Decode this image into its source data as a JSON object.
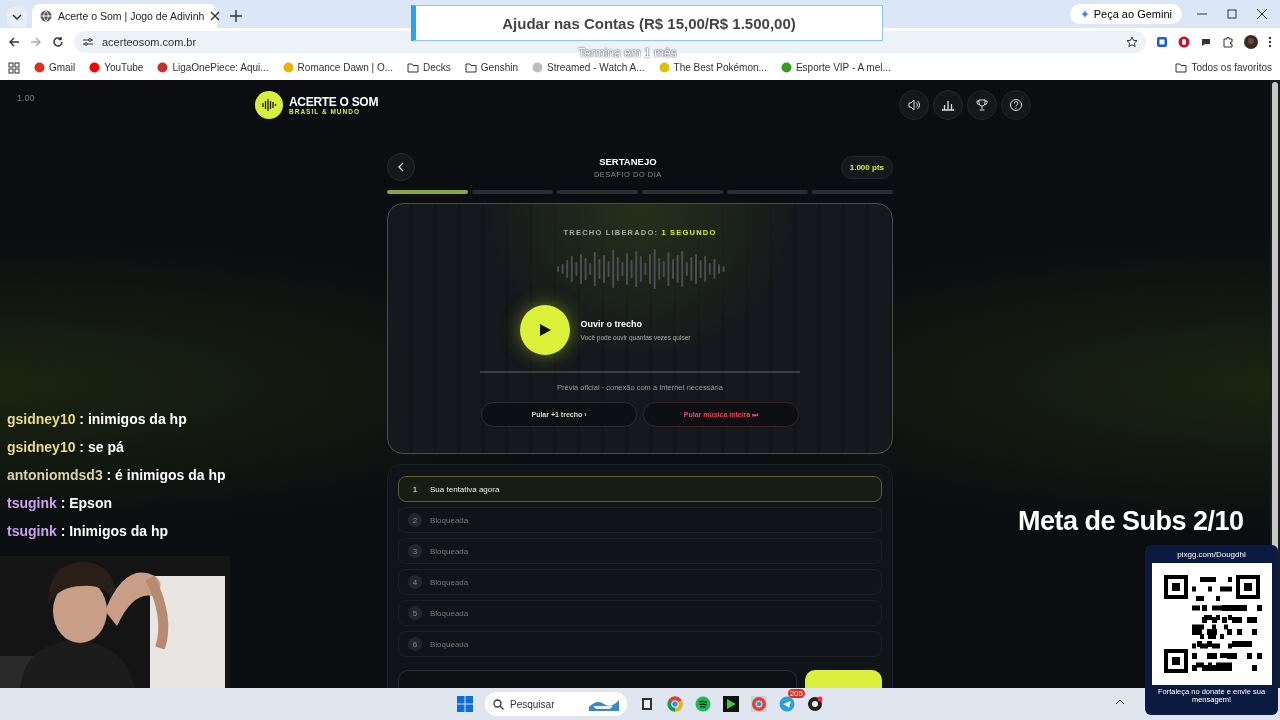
{
  "browser": {
    "tab_title": "Acerte o Som | Jogo de Adivinh",
    "url": "acerteosom.com.br",
    "gemini": "Peça ao Gemini",
    "all_bookmarks": "Todos os favoritos",
    "bookmarks": [
      {
        "label": "Gmail",
        "kind": "site"
      },
      {
        "label": "YouTube",
        "kind": "site"
      },
      {
        "label": "LigaOnePiece: Aqui...",
        "kind": "site"
      },
      {
        "label": "Romance Dawn | O...",
        "kind": "site"
      },
      {
        "label": "Decks",
        "kind": "folder"
      },
      {
        "label": "Genshin",
        "kind": "folder"
      },
      {
        "label": "Streamed - Watch A...",
        "kind": "site"
      },
      {
        "label": "The Best Pokémon...",
        "kind": "site"
      },
      {
        "label": "Esporte VIP - A mel...",
        "kind": "site"
      }
    ]
  },
  "zoom_level": "1.00",
  "app": {
    "logo_title": "ACERTE O SOM",
    "logo_subtitle": "BRASIL & MUNDO",
    "genre": "SERTANEJO",
    "mode": "DESAFIO DO DIA",
    "points": "1.000 pts",
    "progress": [
      {
        "done": true
      },
      {
        "done": false
      },
      {
        "done": false
      },
      {
        "done": false
      },
      {
        "done": false
      },
      {
        "done": false
      }
    ],
    "unlocked_label": "TRECHO LIBERADO:",
    "unlocked_value": "1 SEGUNDO",
    "play_title": "Ouvir o trecho",
    "play_hint": "Você pode ouvir quantas vezes quiser",
    "note": "Prévia oficial · conexão com a Internet necessária",
    "skip_one": "Pular +1 trecho ›",
    "skip_all": "Pular música inteira ⏭",
    "attempts": [
      {
        "number": "1",
        "label": "Sua tentativa agora",
        "current": true
      },
      {
        "number": "2",
        "label": "Bloqueada",
        "current": false
      },
      {
        "number": "3",
        "label": "Bloqueada",
        "current": false
      },
      {
        "number": "4",
        "label": "Bloqueada",
        "current": false
      },
      {
        "number": "5",
        "label": "Bloqueada",
        "current": false
      },
      {
        "number": "6",
        "label": "Bloqueada",
        "current": false
      }
    ]
  },
  "overlay": {
    "donation": "Ajudar nas Contas (R$ 15,00/R$ 1.500,00)",
    "donation_timer": "Termina em 1 mês",
    "chat": [
      {
        "user": "gsidney10",
        "message": ": inimigos da hp",
        "color": "#eadb8e"
      },
      {
        "user": "gsidney10",
        "message": ": se pá",
        "color": "#eadb8e"
      },
      {
        "user": "antoniomdsd3",
        "message": ": é inimigos da hp",
        "color": "#dcd3a4"
      },
      {
        "user": "tsugink",
        "message": ": Epson",
        "color": "#c9a2ee"
      },
      {
        "user": "tsugink",
        "message": ": Inimigos da hp",
        "color": "#c9a2ee"
      }
    ],
    "sub_goal": "Meta de Subs 2/10",
    "qr_url": "pixgg.com/Dougdhl",
    "qr_caption": "Fortaleça no donate e envie sua mensagem!"
  },
  "taskbar": {
    "search": "Pesquisar",
    "badge": "205"
  }
}
